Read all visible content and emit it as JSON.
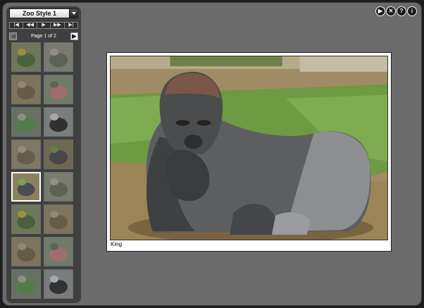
{
  "gallery": {
    "style_label": "Zoo Style 1",
    "page_text": "Page 1 of 2",
    "caption": "King"
  },
  "controls": [
    {
      "name": "first-icon",
      "glyph": "|◀"
    },
    {
      "name": "rewind-icon",
      "glyph": "◀◀"
    },
    {
      "name": "play-icon",
      "glyph": "▶"
    },
    {
      "name": "fast-forward-icon",
      "glyph": "▶▶"
    },
    {
      "name": "last-icon",
      "glyph": "▶|"
    }
  ],
  "toolbar": {
    "play_glyph": "▶",
    "fullscreen_glyph": "✕",
    "info_glyph": "?",
    "about_glyph": "i"
  },
  "pager_glyphs": {
    "prev": "◀",
    "next": "▶"
  },
  "thumbnails": [
    "bird",
    "gecko",
    "lizard",
    "flamingo",
    "chameleon",
    "penguin",
    "reptile",
    "gorilla",
    "gorilla",
    "gecko",
    "bird",
    "lizard",
    "lizard",
    "flamingo",
    "chameleon",
    "penguin"
  ],
  "selected_thumbnail": 8
}
